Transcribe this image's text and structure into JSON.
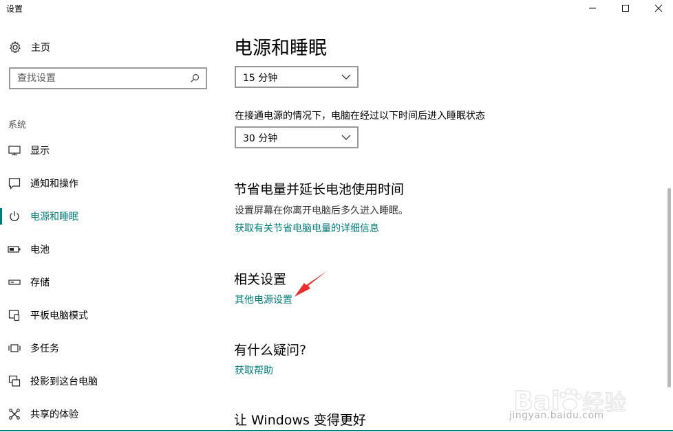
{
  "window": {
    "title": "设置",
    "minimize": "—",
    "maximize": "☐",
    "close": "✕"
  },
  "sidebar": {
    "home_label": "主页",
    "search_placeholder": "查找设置",
    "section": "系统",
    "items": [
      {
        "label": "显示",
        "icon": "display-icon"
      },
      {
        "label": "通知和操作",
        "icon": "notification-icon"
      },
      {
        "label": "电源和睡眠",
        "icon": "power-icon",
        "active": true
      },
      {
        "label": "电池",
        "icon": "battery-icon"
      },
      {
        "label": "存储",
        "icon": "storage-icon"
      },
      {
        "label": "平板电脑模式",
        "icon": "tablet-mode-icon"
      },
      {
        "label": "多任务",
        "icon": "multitask-icon"
      },
      {
        "label": "投影到这台电脑",
        "icon": "project-icon"
      },
      {
        "label": "共享的体验",
        "icon": "shared-experience-icon"
      }
    ]
  },
  "main": {
    "title": "电源和睡眠",
    "screen_timeout_value": "15 分钟",
    "sleep_caption": "在接通电源的情况下，电脑在经过以下时间后进入睡眠状态",
    "sleep_timeout_value": "30 分钟",
    "save_power": {
      "heading": "节省电量并延长电池使用时间",
      "description": "设置屏幕在你离开电脑后多久进入睡眠。",
      "link": "获取有关节省电脑电量的详细信息"
    },
    "related": {
      "heading": "相关设置",
      "link": "其他电源设置"
    },
    "question": {
      "heading": "有什么疑问?",
      "link": "获取帮助"
    },
    "improve": {
      "heading": "让 Windows 变得更好"
    }
  },
  "watermark": {
    "text": "Baidu经验",
    "url": "jingyan.baidu.com"
  },
  "colors": {
    "accent": "#007b7b",
    "annotation_arrow": "#e8312e"
  }
}
